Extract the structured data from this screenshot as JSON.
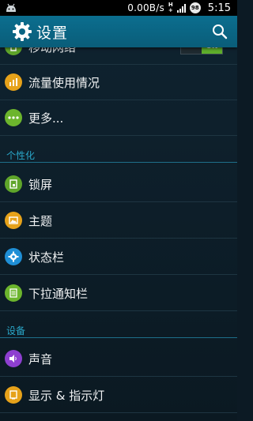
{
  "status_bar": {
    "net_speed": "0.00B/s",
    "network_type_top": "H",
    "network_type_bottom": "+",
    "battery_level": "98",
    "time": "5:15"
  },
  "action_bar": {
    "title": "设置"
  },
  "list": {
    "partial_item": {
      "label": "移动网络",
      "toggle": "ON"
    },
    "items_1": [
      {
        "label": "流量使用情况",
        "icon": "bar-chart-icon",
        "color": "#e6a21a"
      },
      {
        "label": "更多...",
        "icon": "more-dots-icon",
        "color": "#6cb52d"
      }
    ],
    "section_personalization": "个性化",
    "items_2": [
      {
        "label": "锁屏",
        "icon": "lock-screen-icon",
        "color": "#5fa52a"
      },
      {
        "label": "主题",
        "icon": "theme-picture-icon",
        "color": "#e6a21a"
      },
      {
        "label": "状态栏",
        "icon": "gear-small-icon",
        "color": "#1f8fd6"
      },
      {
        "label": "下拉通知栏",
        "icon": "notification-panel-icon",
        "color": "#6cb52d"
      }
    ],
    "section_device": "设备",
    "items_3": [
      {
        "label": "声音",
        "icon": "speaker-icon",
        "color": "#8e3fd0"
      },
      {
        "label": "显示 & 指示灯",
        "icon": "display-icon",
        "color": "#e6a21a"
      }
    ]
  }
}
